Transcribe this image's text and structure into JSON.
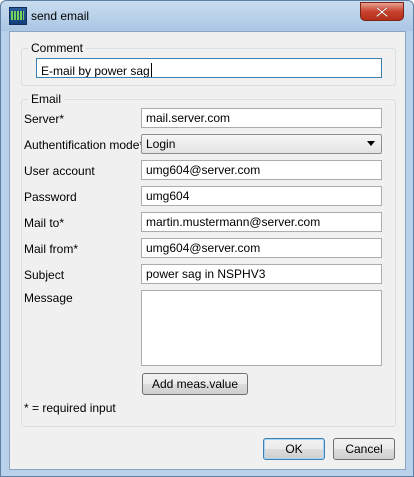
{
  "window": {
    "title": "send email",
    "icon": "app-waveform-icon"
  },
  "comment": {
    "legend": "Comment",
    "value": "E-mail by power sag"
  },
  "email": {
    "legend": "Email",
    "server_label": "Server*",
    "server_value": "mail.server.com",
    "auth_label": "Authentification mode*",
    "auth_value": "Login",
    "user_label": "User account",
    "user_value": "umg604@server.com",
    "password_label": "Password",
    "password_value": "umg604",
    "mail_to_label": "Mail to*",
    "mail_to_value": "martin.mustermann@server.com",
    "mail_from_label": "Mail from*",
    "mail_from_value": "umg604@server.com",
    "subject_label": "Subject",
    "subject_value": "power sag in NSPHV3",
    "message_label": "Message",
    "message_value": "",
    "add_button": "Add meas.value",
    "required_note": "* = required input"
  },
  "buttons": {
    "ok": "OK",
    "cancel": "Cancel"
  }
}
